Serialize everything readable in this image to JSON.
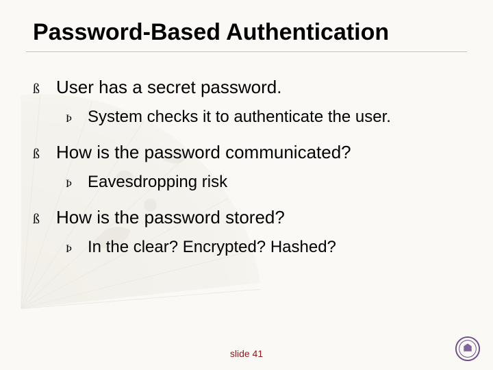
{
  "title": "Password-Based Authentication",
  "bullets": [
    {
      "text": "User has a secret password.",
      "sub": "System checks it to authenticate the user."
    },
    {
      "text": "How is the password communicated?",
      "sub": "Eavesdropping risk"
    },
    {
      "text": "How is the password stored?",
      "sub": "In the clear? Encrypted? Hashed?"
    }
  ],
  "footer": "slide 41",
  "glyphs": {
    "level1": "ß",
    "level2": "Þ"
  }
}
